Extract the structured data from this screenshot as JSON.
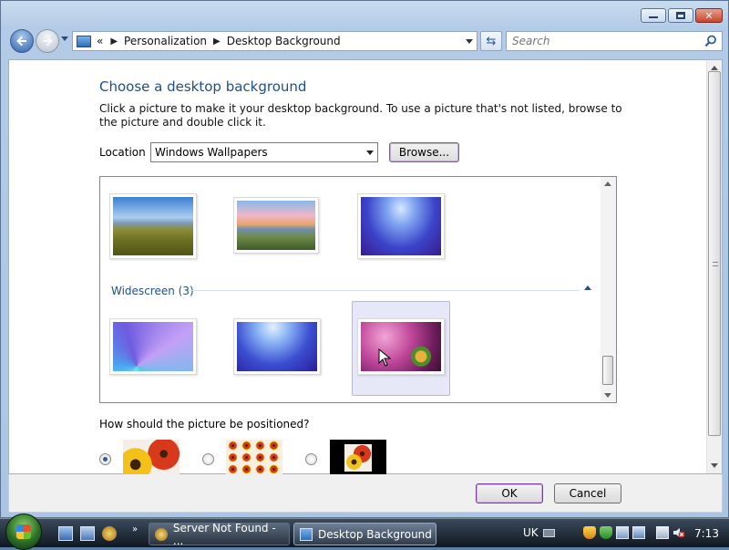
{
  "window": {
    "title": "Desktop Background"
  },
  "addressbar": {
    "overflow_glyph": "«",
    "breadcrumbs": [
      "Personalization",
      "Desktop Background"
    ],
    "separator": "▶",
    "search_placeholder": "Search"
  },
  "main": {
    "heading": "Choose a desktop background",
    "description": "Click a picture to make it your desktop background. To use a picture that's not listed, browse to the picture and double click it.",
    "location_label": "Location",
    "location_value": "Windows Wallpapers",
    "browse_label": "Browse...",
    "group_name": "Widescreen (3)",
    "position_question": "How should the picture be positioned?",
    "position_options": [
      "fit-to-screen",
      "tile",
      "center"
    ],
    "selected_position": "fit-to-screen"
  },
  "gallery": {
    "top_row": [
      "beach-grass",
      "sunset-lake",
      "blue-aurora"
    ],
    "widescreen_row": [
      "blue-rays",
      "blue-aurora-wide",
      "windows-flower-pink"
    ],
    "selected": "windows-flower-pink"
  },
  "dialog": {
    "ok_label": "OK",
    "cancel_label": "Cancel"
  },
  "taskbar": {
    "tasks": [
      {
        "label": "Server Not Found - ...",
        "active": false
      },
      {
        "label": "Desktop Background",
        "active": true
      }
    ],
    "language": "UK",
    "clock": "7:13",
    "quick_launch_arrow": "»"
  },
  "colors": {
    "heading": "#1e4f8a",
    "accent_focus": "#7b3e9e"
  }
}
